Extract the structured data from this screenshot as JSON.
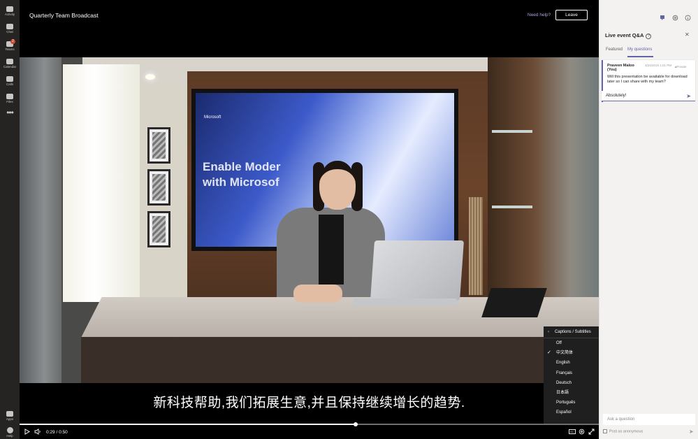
{
  "rail": {
    "items": [
      {
        "label": "Activity",
        "icon": "bell-icon"
      },
      {
        "label": "Chat",
        "icon": "chat-icon"
      },
      {
        "label": "Teams",
        "icon": "teams-icon",
        "badge": "2"
      },
      {
        "label": "Calendar",
        "icon": "calendar-icon"
      },
      {
        "label": "Calls",
        "icon": "phone-icon"
      },
      {
        "label": "Files",
        "icon": "file-icon"
      }
    ],
    "more": "•••",
    "bottom": [
      {
        "label": "Apps",
        "icon": "apps-icon"
      },
      {
        "label": "Help",
        "icon": "help-icon"
      }
    ]
  },
  "header": {
    "title": "Quarterly Team Broadcast",
    "need_help": "Need help?",
    "leave": "Leave"
  },
  "video": {
    "slide_logo": "Microsoft",
    "slide_text_1": "Enable Moder",
    "slide_text_2": "with Microsof"
  },
  "captions": {
    "header": "Captions / Subtitles",
    "options": [
      "Off",
      "中文简体",
      "English",
      "Français",
      "Deutsch",
      "日本語",
      "Português",
      "Español"
    ],
    "selected": "中文简体",
    "subtitle": "新科技帮助,我们拓展生意,并且保持继续增长的趋势."
  },
  "player": {
    "current_time": "0:29",
    "separator": "/",
    "duration": "0:50",
    "progress": 0.58
  },
  "qa": {
    "title": "Live event Q&A",
    "tabs": [
      "Featured",
      "My questions"
    ],
    "active_tab": "My questions",
    "question": {
      "author": "Praveen Maloo (You)",
      "date": "3/24/2019 1:01 PM",
      "visibility": "Private",
      "text": "Will this presentation be available for download later so I can share with my team?",
      "reply": "Absolutely!"
    },
    "ask_placeholder": "Ask a question",
    "anonymous_label": "Post as anonymous"
  },
  "colors": {
    "accent": "#6264a7",
    "rail_bg": "#252423",
    "panel_bg": "#f3f2f1",
    "badge": "#cc4a31"
  }
}
